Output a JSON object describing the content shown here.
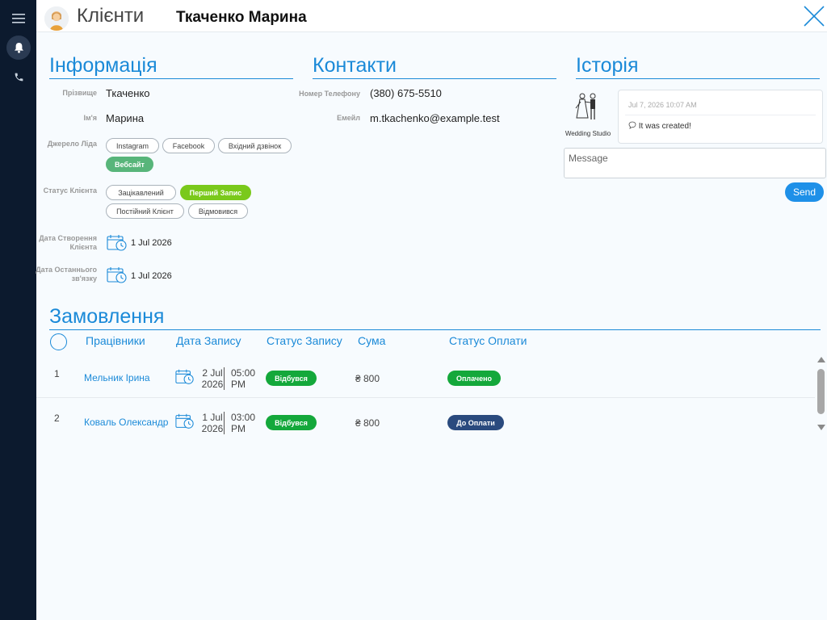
{
  "header": {
    "section_title": "Клієнти",
    "client_name": "Ткаченко Марина"
  },
  "info": {
    "heading": "Інформація",
    "surname_label": "Прізвище",
    "surname_value": "Ткаченко",
    "name_label": "Ім'я",
    "name_value": "Марина",
    "lead_source_label": "Джерело Ліда",
    "lead_sources": [
      {
        "label": "Instagram",
        "selected": false
      },
      {
        "label": "Facebook",
        "selected": false
      },
      {
        "label": "Вхідний дзвінок",
        "selected": false
      },
      {
        "label": "Вебсайт",
        "selected": true
      }
    ],
    "client_status_label": "Статус Клієнта",
    "client_statuses": [
      {
        "label": "Зацікавлений",
        "selected": false
      },
      {
        "label": "Перший Запис",
        "selected": true
      },
      {
        "label": "Постійний Клієнт",
        "selected": false
      },
      {
        "label": "Відмовився",
        "selected": false
      }
    ],
    "created_label_1": "Дата Створення",
    "created_label_2": "Клієнта",
    "created_value": "1 Jul 2026",
    "last_contact_label_1": "Дата Останнього",
    "last_contact_label_2": "зв'язку",
    "last_contact_value": "1 Jul 2026"
  },
  "contacts": {
    "heading": "Контакти",
    "phone_label": "Номер Телефону",
    "phone_value": "(380) 675-5510",
    "email_label": "Емейл",
    "email_value": "m.tkachenko@example.test"
  },
  "history": {
    "heading": "Історія",
    "logo_label": "Wedding Studio",
    "entry_time": "Jul 7, 2026 10:07 AM",
    "entry_text": "It was created!",
    "message_placeholder": "Message",
    "send_label": "Send"
  },
  "orders": {
    "heading": "Замовлення",
    "columns": {
      "employees": "Працівники",
      "date": "Дата Запису",
      "status": "Статус Запису",
      "sum": "Сума",
      "payment": "Статус Оплати"
    },
    "rows": [
      {
        "num": "1",
        "employee": "Мельник Ірина",
        "date_day": "2 Jul",
        "date_year": "2026",
        "time": "05:00",
        "ampm": "PM",
        "status": "Відбувся",
        "sum": "₴ 800",
        "payment": "Оплачено"
      },
      {
        "num": "2",
        "employee": "Коваль Олександр",
        "date_day": "1 Jul",
        "date_year": "2026",
        "time": "03:00",
        "ampm": "PM",
        "status": "Відбувся",
        "sum": "₴ 800",
        "payment": "До Оплати"
      }
    ]
  },
  "colors": {
    "accent": "#1b8ad8",
    "sidebar": "#0c1a2e",
    "status_done": "#14a83b",
    "paid": "#14a83b",
    "to_pay": "#2a4a7e",
    "source_selected": "#58b57a",
    "status_selected": "#7ac91b"
  }
}
